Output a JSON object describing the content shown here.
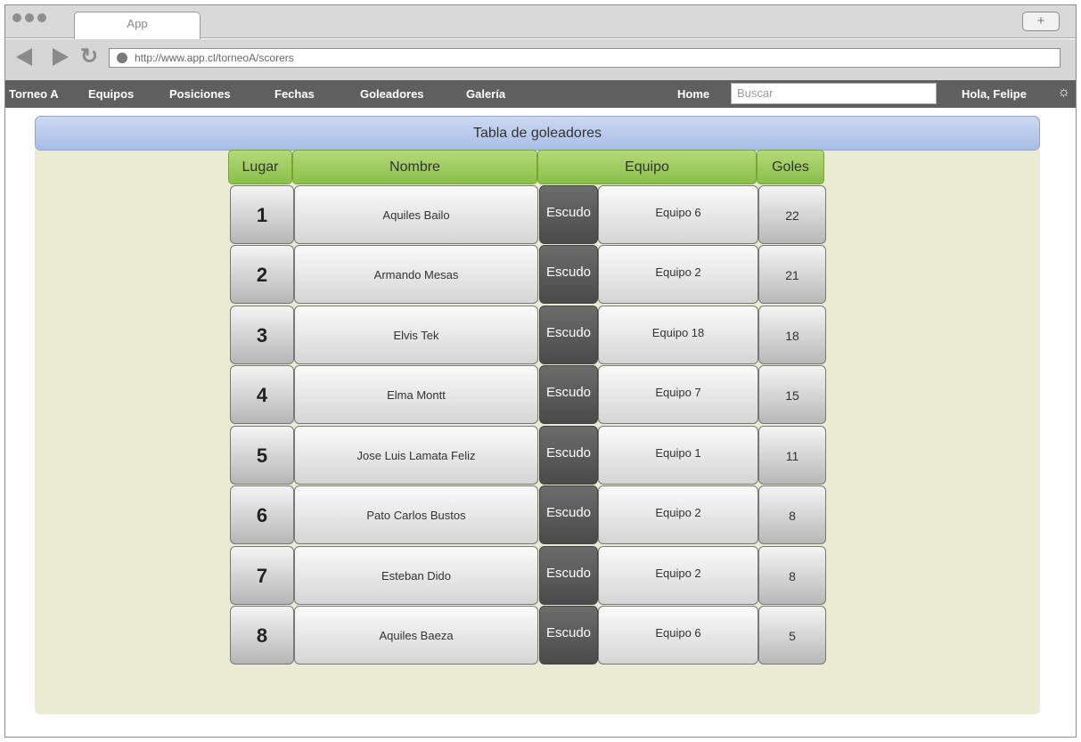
{
  "browser": {
    "tab_title": "App",
    "new_tab_label": "+",
    "url": "http://www.app.cl/torneoA/scorers"
  },
  "menu": {
    "brand": "Torneo A",
    "items": [
      "Equipos",
      "Posiciones",
      "Fechas",
      "Goleadores",
      "Galería"
    ],
    "home": "Home",
    "search_placeholder": "Buscar",
    "greeting": "Hola, Felipe",
    "settings_icon": "gear-icon"
  },
  "page": {
    "title": "Tabla de goleadores"
  },
  "table": {
    "headers": {
      "place": "Lugar",
      "name": "Nombre",
      "team": "Equipo",
      "goals": "Goles"
    },
    "rows": [
      {
        "place": "1",
        "name": "Aquiles Bailo",
        "crest": "Escudo",
        "team": "Equipo 6",
        "goals": "22"
      },
      {
        "place": "2",
        "name": "Armando Mesas",
        "crest": "Escudo",
        "team": "Equipo 2",
        "goals": "21"
      },
      {
        "place": "3",
        "name": "Elvis Tek",
        "crest": "Escudo",
        "team": "Equipo 18",
        "goals": "18"
      },
      {
        "place": "4",
        "name": "Elma Montt",
        "crest": "Escudo",
        "team": "Equipo 7",
        "goals": "15"
      },
      {
        "place": "5",
        "name": "Jose Luis Lamata Feliz",
        "crest": "Escudo",
        "team": "Equipo 1",
        "goals": "11"
      },
      {
        "place": "6",
        "name": "Pato Carlos Bustos",
        "crest": "Escudo",
        "team": "Equipo 2",
        "goals": "8"
      },
      {
        "place": "7",
        "name": "Esteban Dido",
        "crest": "Escudo",
        "team": "Equipo 2",
        "goals": "8"
      },
      {
        "place": "8",
        "name": "Aquiles Baeza",
        "crest": "Escudo",
        "team": "Equipo 6",
        "goals": "5"
      }
    ]
  }
}
